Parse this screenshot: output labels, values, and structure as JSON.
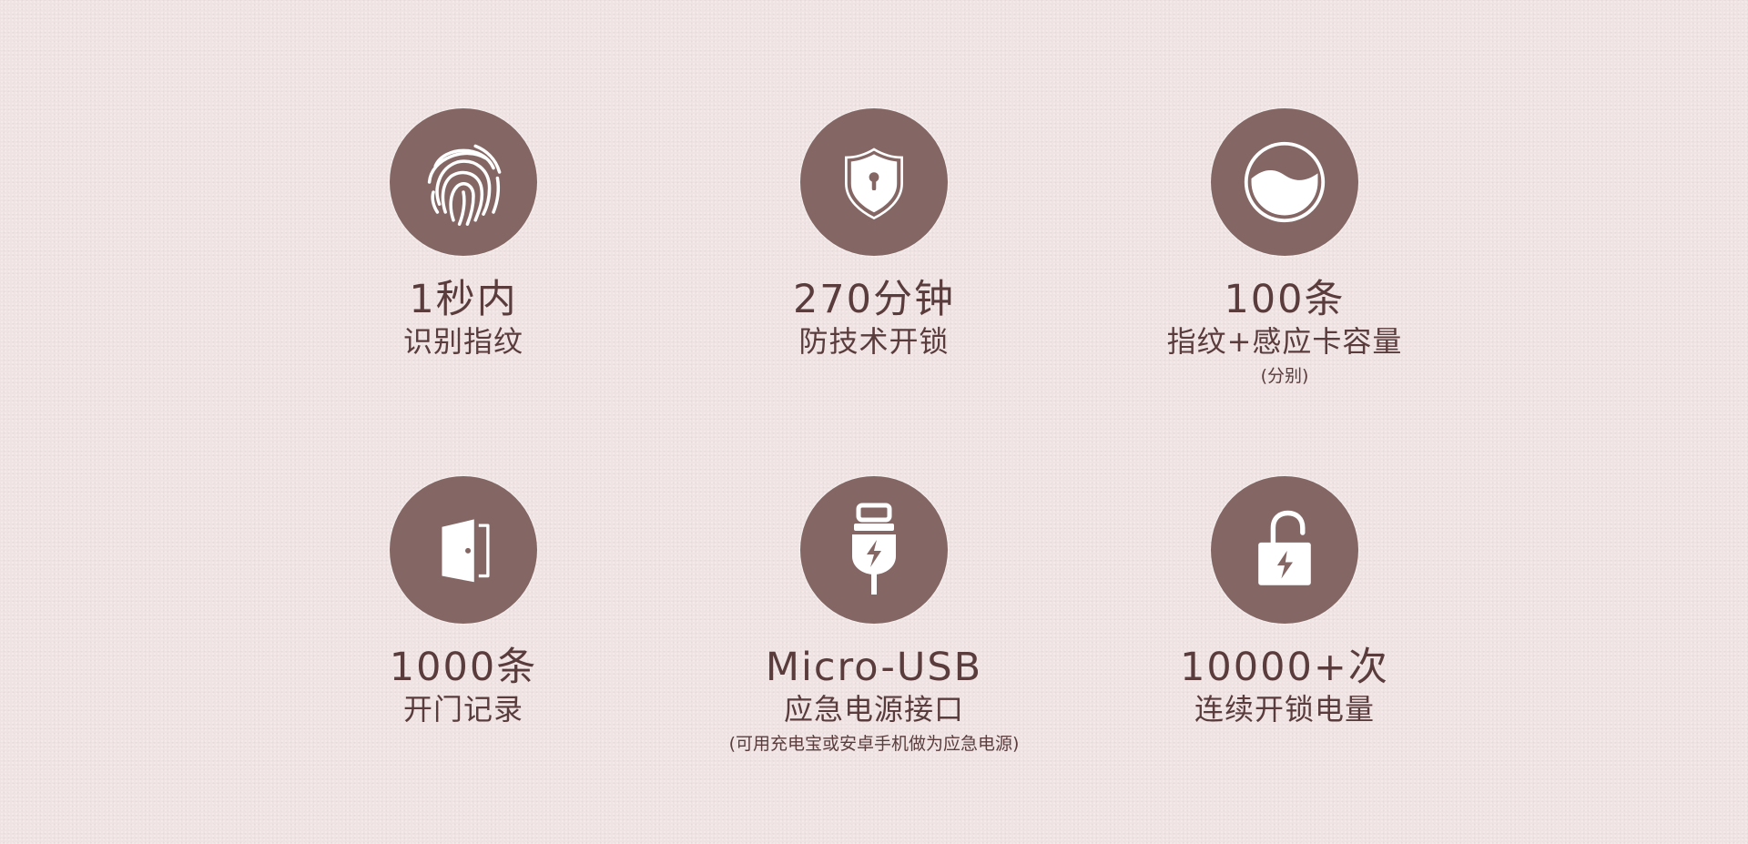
{
  "colors": {
    "background": "#efe3e3",
    "circle": "#846764",
    "text": "#5a3c3c",
    "icon": "#ffffff"
  },
  "features": [
    {
      "icon": "fingerprint-icon",
      "headline": "1秒内",
      "label": "识别指纹"
    },
    {
      "icon": "shield-lock-icon",
      "headline": "270分钟",
      "label": "防技术开锁"
    },
    {
      "icon": "capacity-icon",
      "headline": "100条",
      "label": "指纹+感应卡容量",
      "note": "(分别)"
    },
    {
      "icon": "door-icon",
      "headline": "1000条",
      "label": "开门记录"
    },
    {
      "icon": "usb-plug-icon",
      "headline": "Micro-USB",
      "label": "应急电源接口",
      "note": "(可用充电宝或安卓手机做为应急电源)"
    },
    {
      "icon": "battery-lock-icon",
      "headline": "10000+次",
      "label": "连续开锁电量"
    }
  ]
}
